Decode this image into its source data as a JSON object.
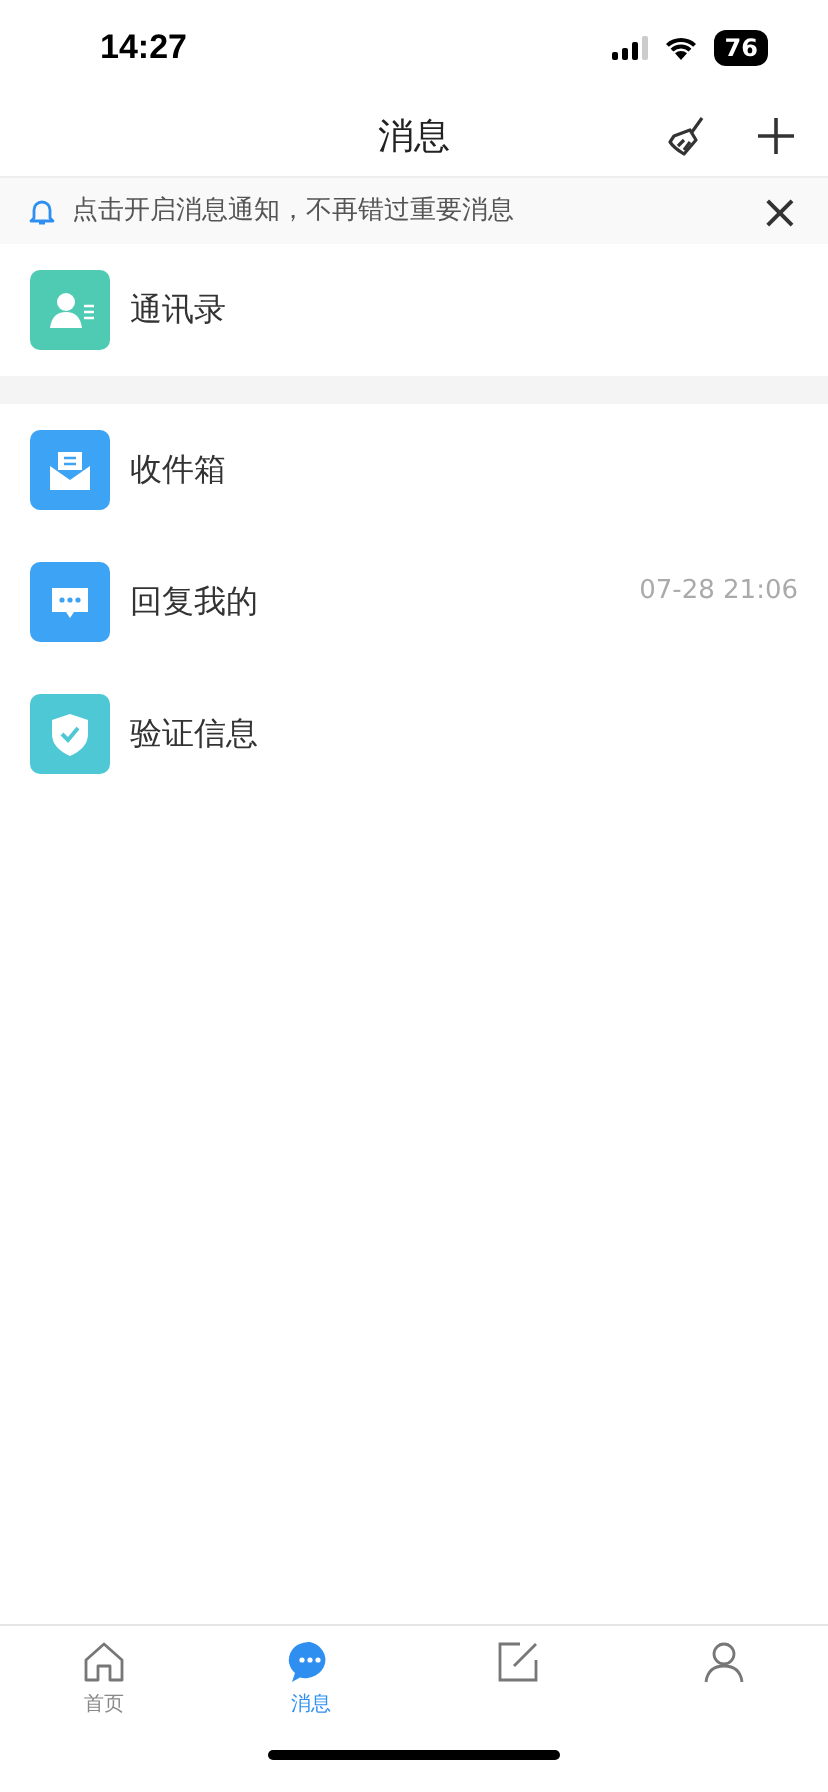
{
  "status_bar": {
    "time": "14:27",
    "battery": "76"
  },
  "header": {
    "title": "消息"
  },
  "notice": {
    "text": "点击开启消息通知，不再错过重要消息",
    "close": "×"
  },
  "contacts": {
    "label": "通讯录"
  },
  "items": [
    {
      "label": "收件箱"
    },
    {
      "label": "回复我的",
      "time": "07-28 21:06"
    },
    {
      "label": "验证信息"
    }
  ],
  "tabs": [
    {
      "label": "首页",
      "selected": false
    },
    {
      "label": "消息",
      "selected": true
    },
    {
      "selected": false
    },
    {
      "selected": false
    }
  ]
}
